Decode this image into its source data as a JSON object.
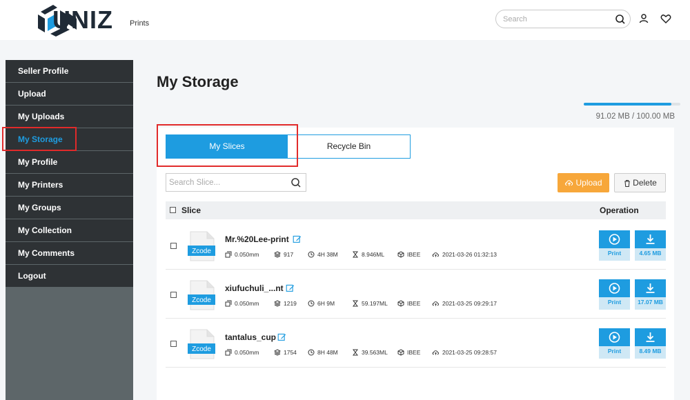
{
  "header": {
    "brand": "UNIZ",
    "nav_prints": "Prints",
    "search_placeholder": "Search",
    "icons": [
      "search-icon",
      "user-icon",
      "heart-icon"
    ]
  },
  "sidebar": {
    "items": [
      {
        "label": "Seller Profile",
        "active": false
      },
      {
        "label": "Upload",
        "active": false
      },
      {
        "label": "My Uploads",
        "active": false
      },
      {
        "label": "My Storage",
        "active": true
      },
      {
        "label": "My Profile",
        "active": false
      },
      {
        "label": "My Printers",
        "active": false
      },
      {
        "label": "My Groups",
        "active": false
      },
      {
        "label": "My Collection",
        "active": false
      },
      {
        "label": "My Comments",
        "active": false
      },
      {
        "label": "Logout",
        "active": false
      }
    ]
  },
  "main": {
    "title": "My Storage",
    "quota": {
      "text": "91.02 MB / 100.00 MB",
      "fraction": 0.91
    },
    "tabs": [
      {
        "label": "My Slices",
        "active": true
      },
      {
        "label": "Recycle Bin",
        "active": false
      }
    ],
    "slice_search_placeholder": "Search Slice...",
    "upload_label": "Upload",
    "delete_label": "Delete",
    "columns": {
      "slice": "Slice",
      "operation": "Operation"
    },
    "file_icon_label": "Zcode",
    "print_label": "Print",
    "rows": [
      {
        "name": "Mr.%20Lee-print",
        "layer": "0.050mm",
        "layers": "917",
        "time": "4H 38M",
        "volume": "8.946ML",
        "resin": "IBEE",
        "date": "2021-03-26 01:32:13",
        "size": "4.65 MB"
      },
      {
        "name": "xiufuchuli_...nt",
        "layer": "0.050mm",
        "layers": "1219",
        "time": "6H 9M",
        "volume": "59.197ML",
        "resin": "IBEE",
        "date": "2021-03-25 09:29:17",
        "size": "17.07 MB"
      },
      {
        "name": "tantalus_cup",
        "layer": "0.050mm",
        "layers": "1754",
        "time": "8H 48M",
        "volume": "39.563ML",
        "resin": "IBEE",
        "date": "2021-03-25 09:28:57",
        "size": "8.49 MB"
      }
    ]
  },
  "colors": {
    "accent": "#1e9ce0",
    "upload": "#f7a73a",
    "highlight": "#e12a2a",
    "sidebar": "#2e3235"
  }
}
